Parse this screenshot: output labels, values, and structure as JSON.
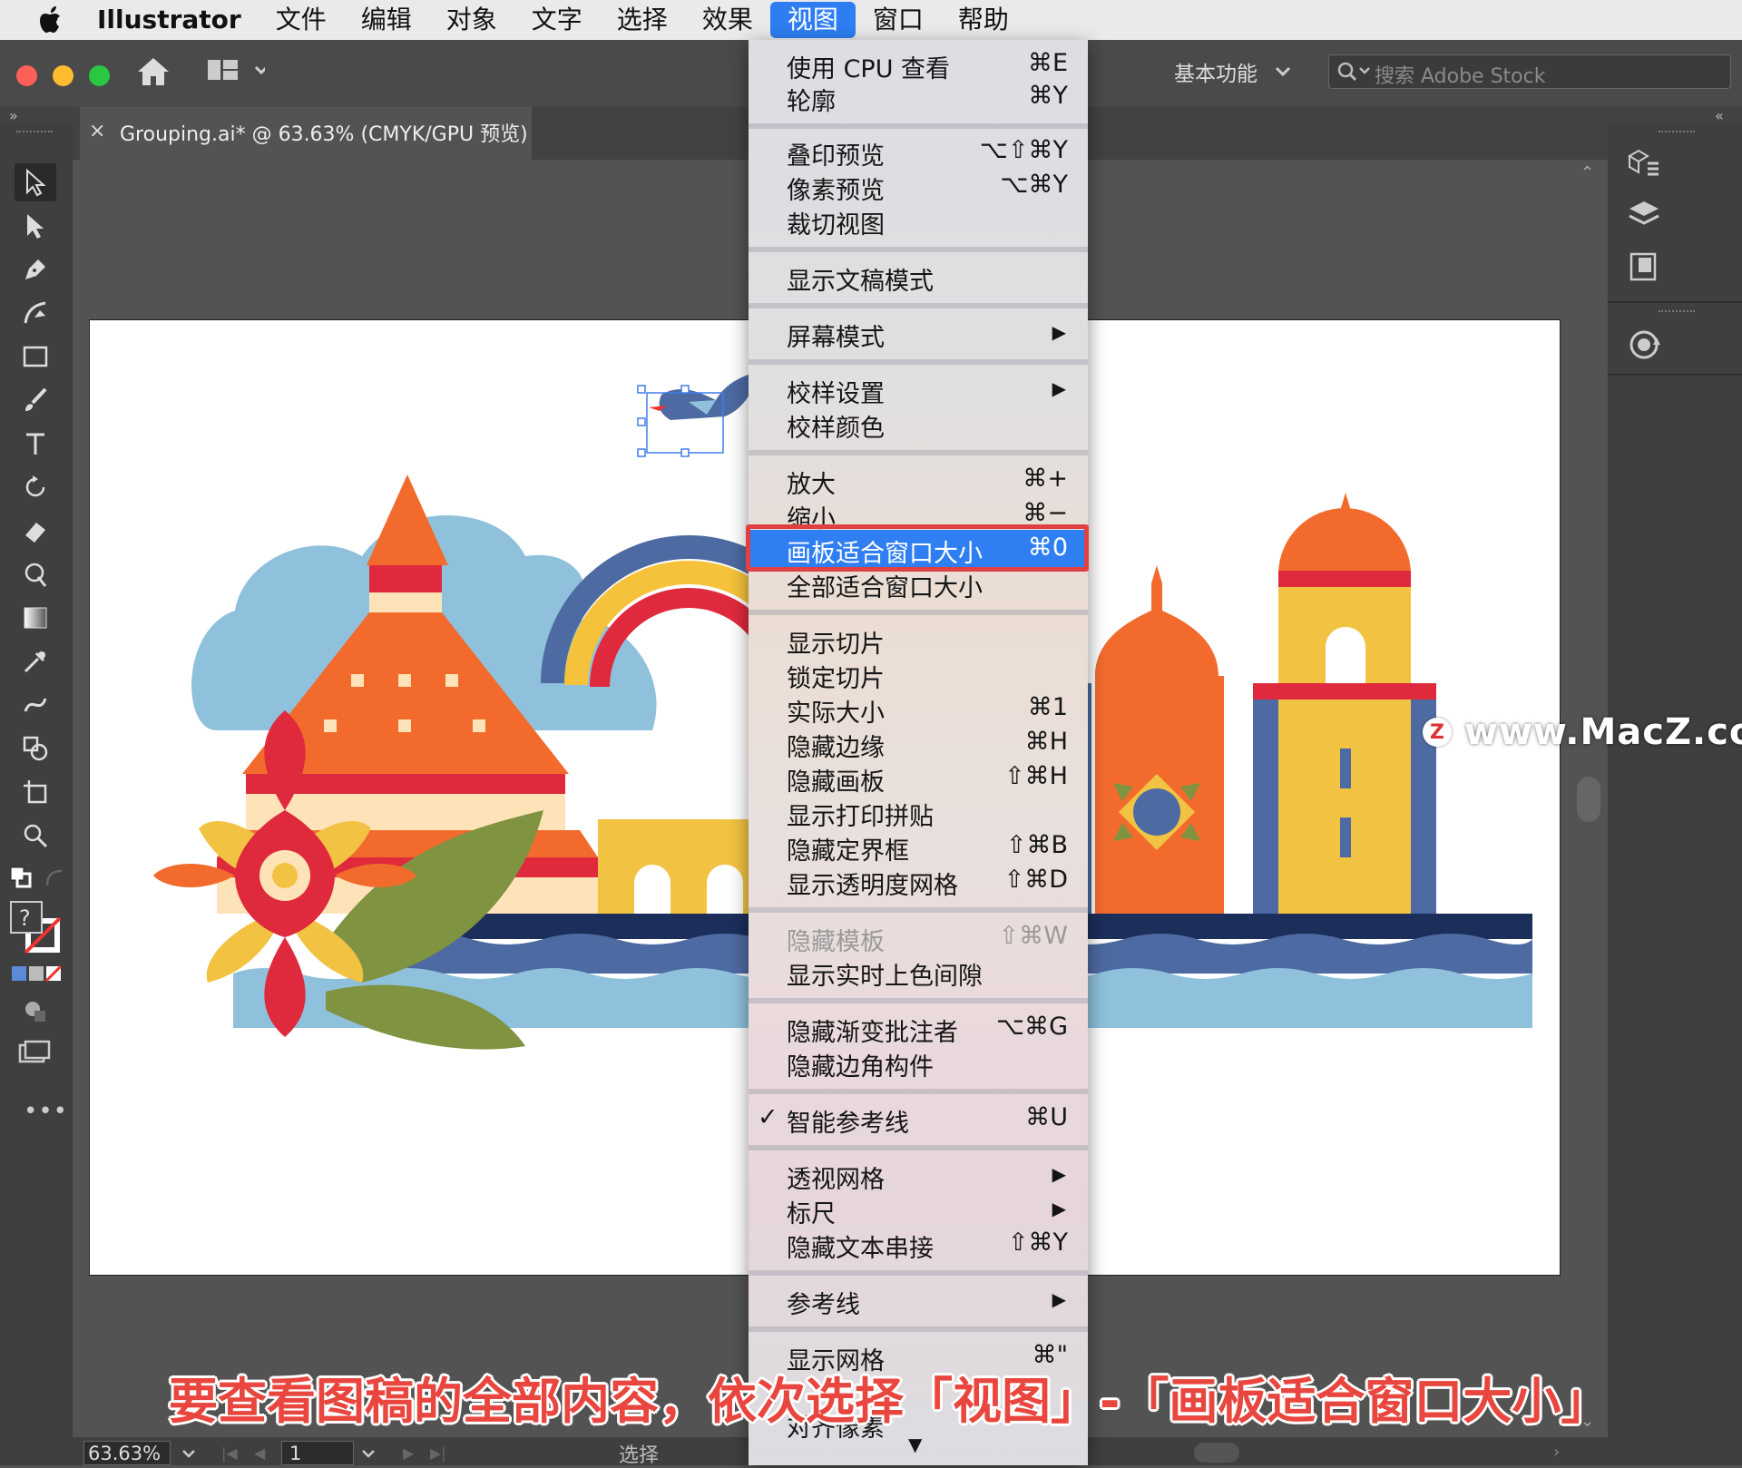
{
  "menubar": {
    "app_name": "Illustrator",
    "items": [
      "文件",
      "编辑",
      "对象",
      "文字",
      "选择",
      "效果",
      "视图",
      "窗口",
      "帮助"
    ],
    "active_item": "视图"
  },
  "toolbar": {
    "workspace_label": "基本功能",
    "search_placeholder": "搜索 Adobe Stock"
  },
  "document_tab": {
    "title": "Grouping.ai* @ 63.63% (CMYK/GPU 预览)",
    "close_glyph": "×"
  },
  "view_menu": {
    "items": [
      {
        "label": "使用 CPU 查看",
        "shortcut": "⌘E"
      },
      {
        "label": "轮廓",
        "shortcut": "⌘Y"
      },
      {
        "label": "叠印预览",
        "shortcut": "⌥⇧⌘Y"
      },
      {
        "label": "像素预览",
        "shortcut": "⌥⌘Y"
      },
      {
        "label": "裁切视图",
        "shortcut": ""
      },
      {
        "label": "显示文稿模式",
        "shortcut": ""
      },
      {
        "label": "屏幕模式",
        "shortcut": "▶"
      },
      {
        "label": "校样设置",
        "shortcut": "▶"
      },
      {
        "label": "校样颜色",
        "shortcut": ""
      },
      {
        "label": "放大",
        "shortcut": "⌘+"
      },
      {
        "label": "缩小",
        "shortcut": "⌘−"
      },
      {
        "label": "画板适合窗口大小",
        "shortcut": "⌘0"
      },
      {
        "label": "全部适合窗口大小",
        "shortcut": ""
      },
      {
        "label": "显示切片",
        "shortcut": ""
      },
      {
        "label": "锁定切片",
        "shortcut": ""
      },
      {
        "label": "实际大小",
        "shortcut": "⌘1"
      },
      {
        "label": "隐藏边缘",
        "shortcut": "⌘H"
      },
      {
        "label": "隐藏画板",
        "shortcut": "⇧⌘H"
      },
      {
        "label": "显示打印拼贴",
        "shortcut": ""
      },
      {
        "label": "隐藏定界框",
        "shortcut": "⇧⌘B"
      },
      {
        "label": "显示透明度网格",
        "shortcut": "⇧⌘D"
      },
      {
        "label": "隐藏模板",
        "shortcut": "⇧⌘W"
      },
      {
        "label": "显示实时上色间隙",
        "shortcut": ""
      },
      {
        "label": "隐藏渐变批注者",
        "shortcut": "⌥⌘G"
      },
      {
        "label": "隐藏边角构件",
        "shortcut": ""
      },
      {
        "label": "智能参考线",
        "shortcut": "⌘U",
        "check": "✓"
      },
      {
        "label": "透视网格",
        "shortcut": "▶"
      },
      {
        "label": "标尺",
        "shortcut": "▶"
      },
      {
        "label": "隐藏文本串接",
        "shortcut": "⇧⌘Y"
      },
      {
        "label": "参考线",
        "shortcut": "▶"
      },
      {
        "label": "显示网格",
        "shortcut": "⌘\""
      },
      {
        "label": "对齐像素",
        "shortcut": ""
      },
      {
        "label": "▼",
        "shortcut": ""
      }
    ]
  },
  "status": {
    "zoom": "63.63%",
    "page": "1",
    "tool": "选择"
  },
  "watermark": {
    "logo": "Z",
    "text": "www.MacZ.com"
  },
  "caption": "要查看图稿的全部内容，依次选择「视图」-「画板适合窗口大小」",
  "colors": {
    "accent": "#2e7ef2",
    "highlight_border": "#e04040",
    "caption": "#e8463e"
  }
}
